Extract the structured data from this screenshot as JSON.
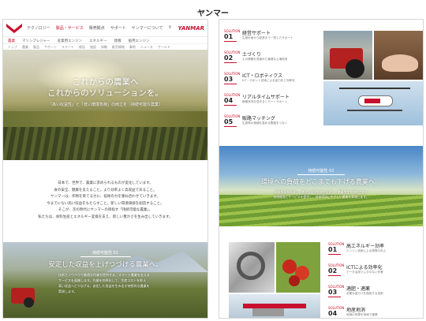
{
  "caption": "ヤンマー",
  "header": {
    "brand": "YANMAR",
    "nav": [
      "テクノロジー",
      "製品・サービス",
      "販売拠点",
      "サポート",
      "ヤンマーについて"
    ],
    "active": 1
  },
  "subnav": {
    "items": [
      "農業",
      "マリンプレジャー",
      "産業用エンジン",
      "エネルギー",
      "建機",
      "舶用エンジン"
    ],
    "active": 0
  },
  "crumbs": [
    "トップ",
    "農業",
    "製品",
    "サポート",
    "スマート",
    "栽培",
    "施設",
    "体験",
    "販売情報",
    "事例",
    "ニュース",
    "ワールド"
  ],
  "hero": {
    "title_1": "これからの農業へ",
    "title_2": "これからのソリューションを。",
    "tagline": "「高い収益性」と「低い環境負荷」の両立を（持続可能な農業）"
  },
  "intro": {
    "lines": [
      "日本で、世界で、農業に求められるものが変化しています。",
      "食の安全、健康を支えること。より効率よく高収益であること。",
      "ヤンマーは、作物を育てる力に、技術の力を重ね合わせていきます。",
      "今までにない高い収益をもたらすこと。新しい環境価値を創造すること。",
      "そこが、次の時代にヤンマーの目指す「持続可能な農業」。",
      "私たちは、食料生産とエネルギー変換を支え、新しい豊かさを生み出していきます。"
    ]
  },
  "sustain1": {
    "badge": "持続可能性 01",
    "title": "安定した収益を上げつづける農業へ。",
    "text": [
      "技術とノウハウで最適な作業を提供する、スマート農業を支える",
      "サービスを展開します。作業を効率化して、生産コストを抑え",
      "高い収益へとつなげる。安定した収益を生み出す持続的な農業を",
      "実現します。"
    ]
  },
  "right": {
    "items": [
      {
        "no": "SOLUTION",
        "n": "01",
        "t": "経営サポート",
        "d": "生産計画から経営まで一貫したサポート"
      },
      {
        "no": "SOLUTION",
        "n": "02",
        "t": "土づくり",
        "d": "土の健康を見極めた最適な土壌改良"
      },
      {
        "no": "SOLUTION",
        "n": "03",
        "t": "ICT・ロボティクス",
        "d": "ICT・ロボット技術による省力化と効率化"
      },
      {
        "no": "SOLUTION",
        "n": "04",
        "t": "リアルタイムサポート",
        "d": "稼働状況を見守るリモートサポート"
      },
      {
        "no": "SOLUTION",
        "n": "05",
        "t": "販路マッチング",
        "d": "生産物の価値を高める販路をつなぐ"
      }
    ]
  },
  "sustain2": {
    "badge": "持続可能性 02",
    "title": "環境への負荷をどこまでも下げる農業へ。",
    "text": [
      "環境負荷を低減し、豊かな自然を守りながら、農業生産を持続させる",
      "技術開発とサービスを提供し、地球環境にやさしい農業を実現します。"
    ]
  },
  "right2": {
    "items": [
      {
        "no": "SOLUTION",
        "n": "01",
        "t": "高エネルギー効率",
        "d": "エンジン技術による燃費の向上"
      },
      {
        "no": "SOLUTION",
        "n": "02",
        "t": "ICTによる効率化",
        "d": "データ活用でムダのない作業"
      },
      {
        "no": "SOLUTION",
        "n": "03",
        "t": "適肥・適薬",
        "d": "必要な量だけを施用する技術"
      },
      {
        "no": "SOLUTION",
        "n": "04",
        "t": "地産地消",
        "d": "地域の資源を地域で循環"
      }
    ]
  }
}
